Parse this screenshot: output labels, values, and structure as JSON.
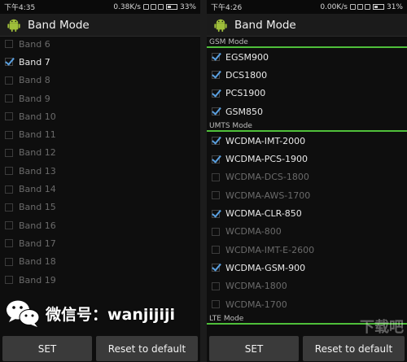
{
  "left": {
    "status": {
      "time": "下午4:35",
      "net": "0.38K/s",
      "battery": "33%"
    },
    "title": "Band Mode",
    "bands": [
      {
        "label": "Band 6",
        "checked": false
      },
      {
        "label": "Band 7",
        "checked": true
      },
      {
        "label": "Band 8",
        "checked": false
      },
      {
        "label": "Band 9",
        "checked": false
      },
      {
        "label": "Band 10",
        "checked": false
      },
      {
        "label": "Band 11",
        "checked": false
      },
      {
        "label": "Band 12",
        "checked": false
      },
      {
        "label": "Band 13",
        "checked": false
      },
      {
        "label": "Band 14",
        "checked": false
      },
      {
        "label": "Band 15",
        "checked": false
      },
      {
        "label": "Band 16",
        "checked": false
      },
      {
        "label": "Band 17",
        "checked": false
      },
      {
        "label": "Band 18",
        "checked": false
      },
      {
        "label": "Band 19",
        "checked": false
      }
    ],
    "buttons": {
      "set": "SET",
      "reset": "Reset to default"
    }
  },
  "right": {
    "status": {
      "time": "下午4:26",
      "net": "0.00K/s",
      "battery": "31%"
    },
    "title": "Band Mode",
    "sections": [
      {
        "header": "GSM Mode",
        "items": [
          {
            "label": "EGSM900",
            "checked": true
          },
          {
            "label": "DCS1800",
            "checked": true
          },
          {
            "label": "PCS1900",
            "checked": true
          },
          {
            "label": "GSM850",
            "checked": true
          }
        ]
      },
      {
        "header": "UMTS Mode",
        "items": [
          {
            "label": "WCDMA-IMT-2000",
            "checked": true
          },
          {
            "label": "WCDMA-PCS-1900",
            "checked": true
          },
          {
            "label": "WCDMA-DCS-1800",
            "checked": false
          },
          {
            "label": "WCDMA-AWS-1700",
            "checked": false
          },
          {
            "label": "WCDMA-CLR-850",
            "checked": true
          },
          {
            "label": "WCDMA-800",
            "checked": false
          },
          {
            "label": "WCDMA-IMT-E-2600",
            "checked": false
          },
          {
            "label": "WCDMA-GSM-900",
            "checked": true
          },
          {
            "label": "WCDMA-1800",
            "checked": false
          },
          {
            "label": "WCDMA-1700",
            "checked": false
          }
        ]
      },
      {
        "header": "LTE Mode",
        "items": []
      }
    ],
    "buttons": {
      "set": "SET",
      "reset": "Reset to default"
    }
  },
  "overlay": {
    "wechat_text": "微信号：wanjijiji",
    "watermark": "下载吧"
  },
  "colors": {
    "check": "#5aa0e0",
    "section_line": "#4fbf3a"
  }
}
